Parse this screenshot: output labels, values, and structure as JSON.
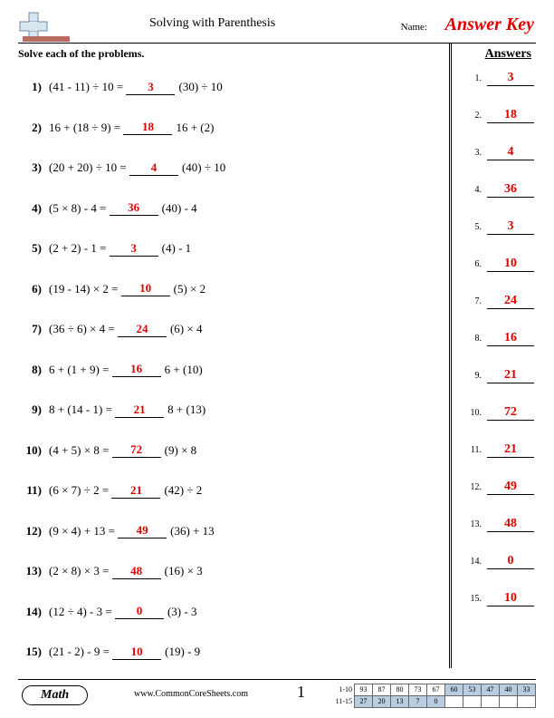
{
  "header": {
    "title": "Solving with Parenthesis",
    "name_label": "Name:",
    "answer_key": "Answer Key"
  },
  "instructions": "Solve each of the problems.",
  "answers_heading": "Answers",
  "problems": [
    {
      "n": "1)",
      "expr": "(41 - 11) ÷ 10 =",
      "ans": "3",
      "after": "(30) ÷ 10"
    },
    {
      "n": "2)",
      "expr": "16 + (18 ÷ 9) =",
      "ans": "18",
      "after": "16 + (2)"
    },
    {
      "n": "3)",
      "expr": "(20 + 20) ÷ 10 =",
      "ans": "4",
      "after": "(40) ÷ 10"
    },
    {
      "n": "4)",
      "expr": "(5 × 8) - 4 =",
      "ans": "36",
      "after": "(40) - 4"
    },
    {
      "n": "5)",
      "expr": "(2 + 2) - 1 =",
      "ans": "3",
      "after": "(4) - 1"
    },
    {
      "n": "6)",
      "expr": "(19 - 14) × 2 =",
      "ans": "10",
      "after": "(5) × 2"
    },
    {
      "n": "7)",
      "expr": "(36 ÷ 6) × 4 =",
      "ans": "24",
      "after": "(6) × 4"
    },
    {
      "n": "8)",
      "expr": "6 + (1 + 9) =",
      "ans": "16",
      "after": "6 + (10)"
    },
    {
      "n": "9)",
      "expr": "8 + (14 - 1) =",
      "ans": "21",
      "after": "8 + (13)"
    },
    {
      "n": "10)",
      "expr": "(4 + 5) × 8 =",
      "ans": "72",
      "after": "(9) × 8"
    },
    {
      "n": "11)",
      "expr": "(6 × 7) ÷ 2 =",
      "ans": "21",
      "after": "(42) ÷ 2"
    },
    {
      "n": "12)",
      "expr": "(9 × 4) + 13 =",
      "ans": "49",
      "after": "(36) + 13"
    },
    {
      "n": "13)",
      "expr": "(2 × 8) × 3 =",
      "ans": "48",
      "after": "(16) × 3"
    },
    {
      "n": "14)",
      "expr": "(12 ÷ 4) - 3 =",
      "ans": "0",
      "after": "(3) - 3"
    },
    {
      "n": "15)",
      "expr": "(21 - 2) - 9 =",
      "ans": "10",
      "after": "(19) - 9"
    }
  ],
  "answers": [
    {
      "n": "1.",
      "v": "3"
    },
    {
      "n": "2.",
      "v": "18"
    },
    {
      "n": "3.",
      "v": "4"
    },
    {
      "n": "4.",
      "v": "36"
    },
    {
      "n": "5.",
      "v": "3"
    },
    {
      "n": "6.",
      "v": "10"
    },
    {
      "n": "7.",
      "v": "24"
    },
    {
      "n": "8.",
      "v": "16"
    },
    {
      "n": "9.",
      "v": "21"
    },
    {
      "n": "10.",
      "v": "72"
    },
    {
      "n": "11.",
      "v": "21"
    },
    {
      "n": "12.",
      "v": "49"
    },
    {
      "n": "13.",
      "v": "48"
    },
    {
      "n": "14.",
      "v": "0"
    },
    {
      "n": "15.",
      "v": "10"
    }
  ],
  "footer": {
    "subject": "Math",
    "url": "www.CommonCoreSheets.com",
    "page": "1",
    "score_row1_label": "1-10",
    "score_row2_label": "11-15",
    "score_row1": [
      "93",
      "87",
      "80",
      "73",
      "67",
      "60",
      "53",
      "47",
      "40",
      "33"
    ],
    "score_row2": [
      "27",
      "20",
      "13",
      "7",
      "0",
      "",
      "",
      "",
      "",
      ""
    ]
  }
}
